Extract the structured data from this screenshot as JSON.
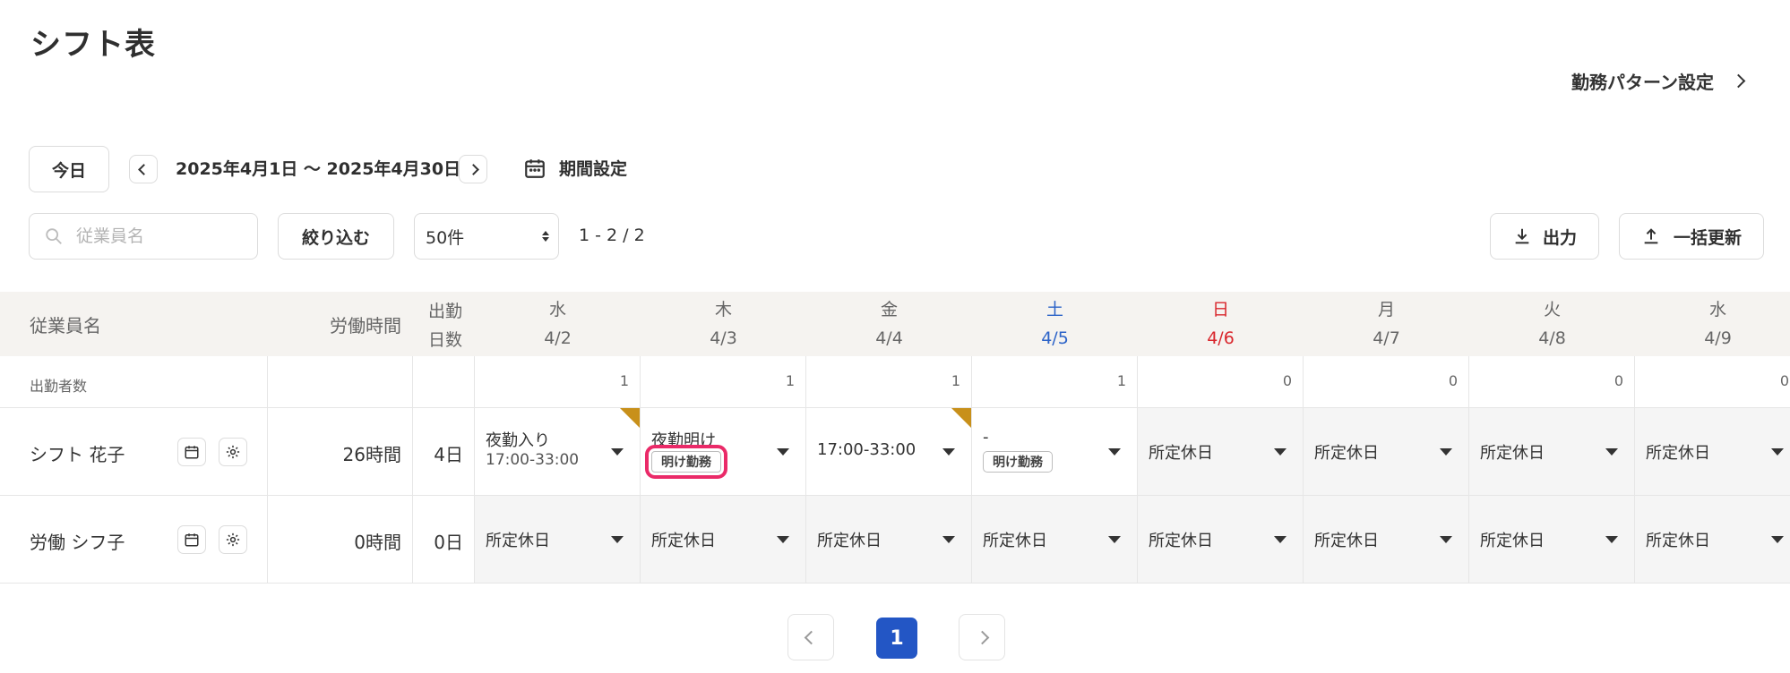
{
  "page": {
    "title": "シフト表"
  },
  "header": {
    "pattern_link": "勤務パターン設定"
  },
  "toolbar": {
    "today_label": "今日",
    "period_text": "2025年4月1日 〜 2025年4月30日",
    "period_setting_label": "期間設定",
    "search_placeholder": "従業員名",
    "filter_label": "絞り込む",
    "per_page_value": "50件",
    "range_text": "1 - 2 / 2",
    "export_label": "出力",
    "bulk_update_label": "一括更新"
  },
  "table": {
    "col_employee": "従業員名",
    "col_hours": "労働時間",
    "col_days_line1": "出勤",
    "col_days_line2": "日数",
    "count_row_label": "出勤者数",
    "days": [
      {
        "weekday": "水",
        "date": "4/2",
        "kind": "weekday",
        "count": "1"
      },
      {
        "weekday": "木",
        "date": "4/3",
        "kind": "weekday",
        "count": "1"
      },
      {
        "weekday": "金",
        "date": "4/4",
        "kind": "weekday",
        "count": "1"
      },
      {
        "weekday": "土",
        "date": "4/5",
        "kind": "sat",
        "count": "1"
      },
      {
        "weekday": "日",
        "date": "4/6",
        "kind": "sun",
        "count": "0"
      },
      {
        "weekday": "月",
        "date": "4/7",
        "kind": "weekday",
        "count": "0"
      },
      {
        "weekday": "火",
        "date": "4/8",
        "kind": "weekday",
        "count": "0"
      },
      {
        "weekday": "水",
        "date": "4/9",
        "kind": "weekday",
        "count": "0"
      }
    ],
    "rows": [
      {
        "name": "シフト 花子",
        "hours": "26時間",
        "days": "4日",
        "cells": [
          {
            "line1": "夜勤入り",
            "line2": "17:00-33:00",
            "badge": "",
            "off": false,
            "flag": true,
            "highlight": false
          },
          {
            "line1": "夜勤明け",
            "line2": "",
            "badge": "明け勤務",
            "off": false,
            "flag": false,
            "highlight": true
          },
          {
            "line1": "17:00-33:00",
            "line2": "",
            "badge": "",
            "off": false,
            "flag": true,
            "highlight": false
          },
          {
            "line1": "-",
            "line2": "",
            "badge": "明け勤務",
            "off": false,
            "flag": false,
            "highlight": false
          },
          {
            "line1": "所定休日",
            "line2": "",
            "badge": "",
            "off": true,
            "flag": false,
            "highlight": false
          },
          {
            "line1": "所定休日",
            "line2": "",
            "badge": "",
            "off": true,
            "flag": false,
            "highlight": false
          },
          {
            "line1": "所定休日",
            "line2": "",
            "badge": "",
            "off": true,
            "flag": false,
            "highlight": false
          },
          {
            "line1": "所定休日",
            "line2": "",
            "badge": "",
            "off": true,
            "flag": false,
            "highlight": false
          }
        ]
      },
      {
        "name": "労働 シフ子",
        "hours": "0時間",
        "days": "0日",
        "cells": [
          {
            "line1": "所定休日",
            "line2": "",
            "badge": "",
            "off": true,
            "flag": false,
            "highlight": false
          },
          {
            "line1": "所定休日",
            "line2": "",
            "badge": "",
            "off": true,
            "flag": false,
            "highlight": false
          },
          {
            "line1": "所定休日",
            "line2": "",
            "badge": "",
            "off": true,
            "flag": false,
            "highlight": false
          },
          {
            "line1": "所定休日",
            "line2": "",
            "badge": "",
            "off": true,
            "flag": false,
            "highlight": false
          },
          {
            "line1": "所定休日",
            "line2": "",
            "badge": "",
            "off": true,
            "flag": false,
            "highlight": false
          },
          {
            "line1": "所定休日",
            "line2": "",
            "badge": "",
            "off": true,
            "flag": false,
            "highlight": false
          },
          {
            "line1": "所定休日",
            "line2": "",
            "badge": "",
            "off": true,
            "flag": false,
            "highlight": false
          },
          {
            "line1": "所定休日",
            "line2": "",
            "badge": "",
            "off": true,
            "flag": false,
            "highlight": false
          }
        ]
      }
    ]
  },
  "pagination": {
    "current_page": "1"
  }
}
